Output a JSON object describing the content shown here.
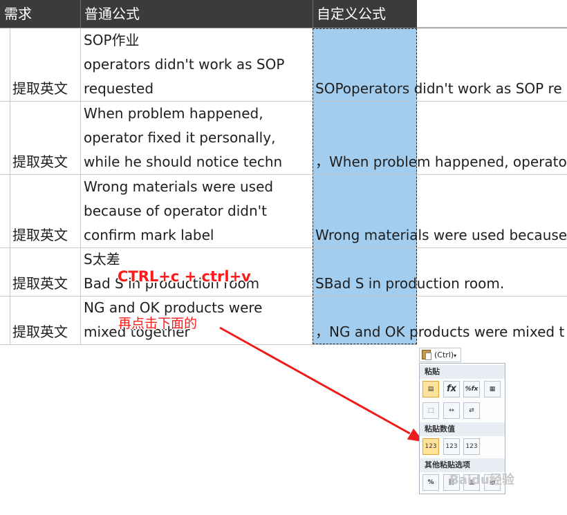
{
  "header": {
    "col1": "需求",
    "col2": "普通公式",
    "col3": "自定义公式"
  },
  "rows": [
    {
      "need": "提取英文",
      "normal": [
        "SOP作业",
        "operators didn't work as SOP",
        "requested"
      ],
      "custom": "SOPoperators didn't work as SOP re"
    },
    {
      "need": "提取英文",
      "normal": [
        "When problem happened,",
        "operator fixed it personally,",
        "while he should notice techn"
      ],
      "custom": "，When problem happened, operato"
    },
    {
      "need": "提取英文",
      "normal": [
        "Wrong materials were used",
        "because of operator didn't",
        "confirm mark label"
      ],
      "custom": "Wrong materials were used because"
    },
    {
      "need": "提取英文",
      "normal": [
        "S太差",
        "Bad S in production room"
      ],
      "custom": "SBad S in production room."
    },
    {
      "need": "提取英文",
      "normal": [
        "NG and OK products were",
        "mixed together"
      ],
      "custom": "，NG and OK products were mixed t"
    }
  ],
  "annotations": {
    "shortcut": "CTRL+c   + ctrl+v",
    "click_hint": "再点击下面的"
  },
  "paste_menu": {
    "button_label": "(Ctrl)",
    "section_paste": "粘贴",
    "section_values": "粘贴数值",
    "section_other": "其他粘贴选项",
    "paste_icons": [
      "paste-icon",
      "formula-icon",
      "formula-number-format-icon",
      "keep-source-format-icon",
      "no-borders-icon",
      "keep-column-width-icon",
      "transpose-icon"
    ],
    "value_icons": [
      "values-icon",
      "values-number-format-icon",
      "values-source-format-icon"
    ],
    "other_icons": [
      "formatting-icon",
      "paste-link-icon",
      "picture-icon",
      "linked-picture-icon"
    ],
    "value_labels": [
      "123",
      "123",
      "123"
    ],
    "formula_label": "fx",
    "formula_pct_label": "%fx",
    "other_pct_label": "%"
  },
  "watermark": "Baidu经验",
  "colors": {
    "header_bg": "#3b3b3b",
    "selection": "#a3cdee",
    "annotation": "#ff1a1a"
  }
}
